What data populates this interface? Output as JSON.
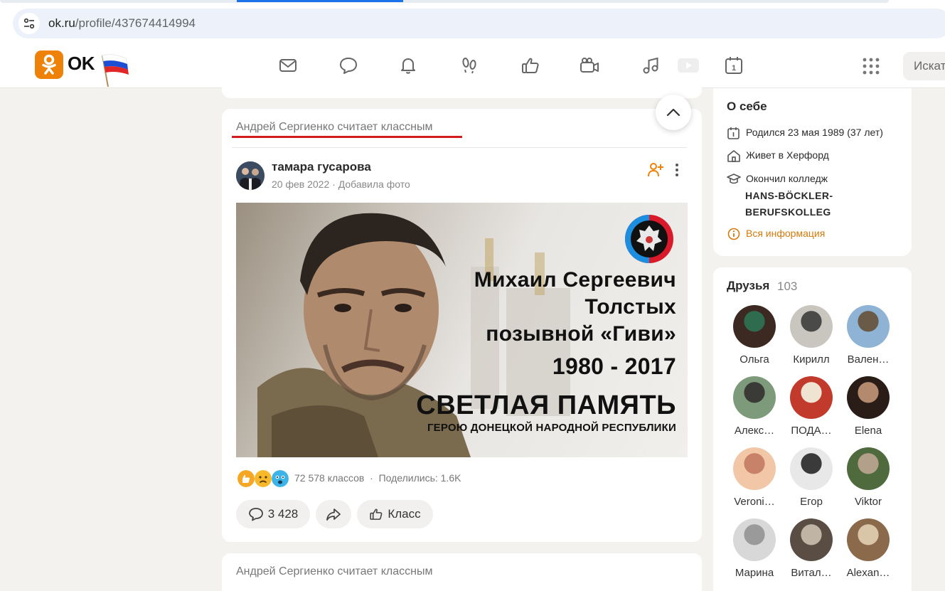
{
  "browser": {
    "url_host": "ok.ru",
    "url_path": "/profile/437674414994"
  },
  "header": {
    "logo_text": "OK",
    "search_placeholder": "Искать",
    "nav_icons": [
      "mail-icon",
      "chat-icon",
      "bell-icon",
      "footsteps-icon",
      "thumb-up-icon",
      "camera-icon",
      "music-icon",
      "video-icon",
      "calendar-icon"
    ],
    "calendar_day": "1"
  },
  "post": {
    "liked_by": "Андрей Сергиенко считает классным",
    "author": "тамара гусарова",
    "date": "20 фев 2022",
    "action": "Добавила фото",
    "photo_text": {
      "line1": "Михаил Сергеевич",
      "line2": "Толстых",
      "line3": "позывной «Гиви»",
      "line4": "1980 - 2017",
      "line5": "СВЕТЛАЯ ПАМЯТЬ",
      "line6": "ГЕРОЮ ДОНЕЦКОЙ НАРОДНОЙ РЕСПУБЛИКИ"
    },
    "classes": "72 578 классов",
    "shared": "Поделились: 1.6K",
    "comments_count": "3 428",
    "class_button": "Класс"
  },
  "post2": {
    "liked_by": "Андрей Сергиенко считает классным"
  },
  "about": {
    "title": "О себе",
    "born": "Родился 23 мая 1989 (37 лет)",
    "lives": "Живет в Херфорд",
    "education": "Окончил колледж",
    "college_line1": "HANS-BÖCKLER-",
    "college_line2": "BERUFSKOLLEG",
    "all_info": "Вся информация"
  },
  "friends": {
    "title": "Друзья",
    "count": "103",
    "list": [
      {
        "name": "Ольга",
        "colors": [
          "#3c2a22",
          "#2f6b4e"
        ]
      },
      {
        "name": "Кирилл",
        "colors": [
          "#c9c6c0",
          "#4a4a48"
        ]
      },
      {
        "name": "Вален…",
        "colors": [
          "#8fb3d4",
          "#6a5a48"
        ]
      },
      {
        "name": "Алекс…",
        "colors": [
          "#7d9a7a",
          "#3a3a36"
        ]
      },
      {
        "name": "ПОДА…",
        "colors": [
          "#c23a2c",
          "#efe4d2"
        ]
      },
      {
        "name": "Elena",
        "colors": [
          "#2a1d18",
          "#b48a6e"
        ]
      },
      {
        "name": "Veroni…",
        "colors": [
          "#f2c7a7",
          "#c9826a"
        ]
      },
      {
        "name": "Егор",
        "colors": [
          "#e8e8e8",
          "#3a3a3a"
        ]
      },
      {
        "name": "Viktor",
        "colors": [
          "#4f6a3d",
          "#b3a08a"
        ]
      },
      {
        "name": "Марина",
        "colors": [
          "#d8d8d8",
          "#9a9a9a"
        ]
      },
      {
        "name": "Витал…",
        "colors": [
          "#5a4e44",
          "#c0b4a4"
        ]
      },
      {
        "name": "Alexan…",
        "colors": [
          "#8a6a4a",
          "#d9c5a8"
        ]
      }
    ]
  }
}
